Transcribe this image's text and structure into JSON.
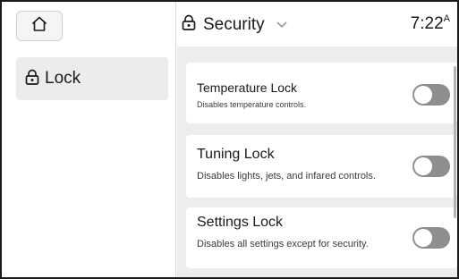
{
  "header": {
    "title": "Security",
    "time": "7:22",
    "time_suffix": "A"
  },
  "sidebar": {
    "items": [
      {
        "label": "Lock",
        "icon": "lock-icon"
      }
    ]
  },
  "settings": [
    {
      "title": "Temperature Lock",
      "description": "Disables temperature controls.",
      "enabled": false
    },
    {
      "title": "Tuning Lock",
      "description": "Disables lights, jets, and infared controls.",
      "enabled": false
    },
    {
      "title": "Settings Lock",
      "description": "Disables all settings except for security.",
      "enabled": false
    }
  ],
  "colors": {
    "toggle_off": "#8e8e8e",
    "panel_bg": "#ededed",
    "card_bg": "#ffffff",
    "selected_item_bg": "#ececec"
  }
}
